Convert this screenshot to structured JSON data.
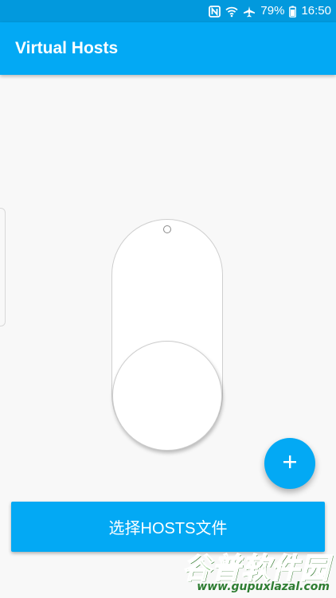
{
  "status_bar": {
    "battery_percent": "79%",
    "time": "16:50",
    "icons": [
      "nfc-icon",
      "wifi-icon",
      "airplane-icon",
      "battery-icon"
    ]
  },
  "app_bar": {
    "title": "Virtual Hosts"
  },
  "toggle": {
    "state": "off"
  },
  "fab": {
    "icon": "plus-icon"
  },
  "primary_button": {
    "label": "选择HOSTS文件"
  },
  "watermark": {
    "title": "谷普软件园",
    "url": "www.gupuxlazal.com"
  },
  "colors": {
    "status_bar": "#0299dd",
    "app_bar": "#03a9f4",
    "background": "#f8f8f8",
    "watermark_green": "#3da12e"
  }
}
